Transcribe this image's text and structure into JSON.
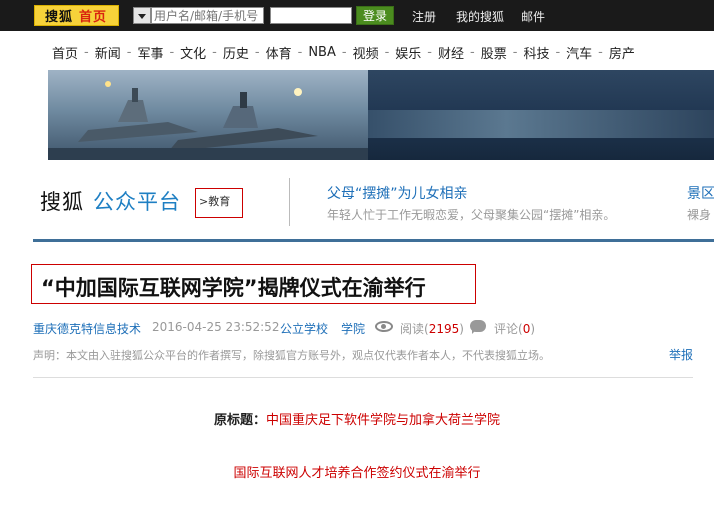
{
  "topbar": {
    "logo_text": "搜狐",
    "logo_home": "首页",
    "username_placeholder": "用户名/邮箱/手机号",
    "login_label": "登录",
    "links": [
      "注册",
      "我的搜狐",
      "邮件"
    ]
  },
  "nav": {
    "items": [
      "首页",
      "新闻",
      "军事",
      "文化",
      "历史",
      "体育",
      "NBA",
      "视频",
      "娱乐",
      "财经",
      "股票",
      "科技",
      "汽车",
      "房产"
    ],
    "separator": "-"
  },
  "header": {
    "brand_sohu": "搜狐",
    "brand_platform": "公众平台",
    "category": ">教育"
  },
  "recommend": [
    {
      "title": "父母“摆摊”为儿女相亲",
      "desc": "年轻人忙于工作无暇恋爱，父母聚集公园“摆摊”相亲。"
    },
    {
      "title": "景区",
      "desc": "裸身"
    }
  ],
  "article": {
    "title": "“中加国际互联网学院”揭牌仪式在渝举行",
    "author": "重庆德克特信息技术",
    "datetime": "2016-04-25 23:52:52",
    "tags": [
      "公立学校",
      "学院"
    ],
    "read_label": "阅读",
    "read_count": "2195",
    "comment_label": "评论",
    "comment_count": "0",
    "disclaimer": "声明：本文由入驻搜狐公众平台的作者撰写，除搜狐官方账号外，观点仅代表作者本人，不代表搜狐立场。",
    "report_label": "举报",
    "orig_label": "原标题：",
    "orig_value": "中国重庆足下软件学院与加拿大荷兰学院",
    "subtitle": "国际互联网人才培养合作签约仪式在渝举行"
  },
  "colors": {
    "topbar_bg": "#1a1a1a",
    "logo_bg": "#f7d23a",
    "link_blue": "#1e6fb8",
    "accent_red": "#cc0000",
    "rule_blue": "#3f6f98"
  }
}
